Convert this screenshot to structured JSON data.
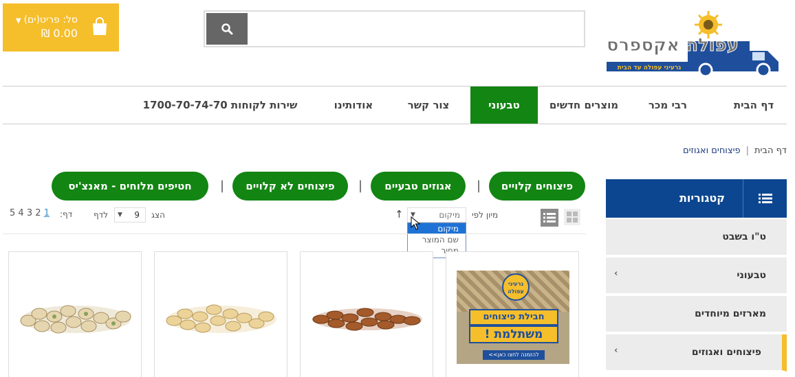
{
  "header": {
    "cart_label": "סל: פריט(ים)",
    "cart_total": "0.00 ₪",
    "search_placeholder": ""
  },
  "logo": {
    "name": "עפולה אקספרס",
    "tagline": "גרעיני עפולה עד הבית"
  },
  "nav": {
    "items": [
      {
        "label": "דף הבית"
      },
      {
        "label": "רבי מכר"
      },
      {
        "label": "מוצרים חדשים"
      },
      {
        "label": "טבעוני",
        "active": true
      },
      {
        "label": "צור קשר"
      },
      {
        "label": "אודותינו"
      },
      {
        "label": "שירות לקוחות 1700-70-74-70"
      }
    ]
  },
  "breadcrumb": {
    "home": "דף הבית",
    "current": "פיצוחים ואגוזים"
  },
  "sidebar": {
    "title": "קטגוריות",
    "items": [
      {
        "label": "ט\"ו בשבט"
      },
      {
        "label": "טבעוני",
        "arrow": "›"
      },
      {
        "label": "מארזים מיוחדים"
      },
      {
        "label": "פיצוחים ואגוזים",
        "arrow": "›",
        "selected": true
      }
    ]
  },
  "subcategories": [
    {
      "label": "פיצוחים קלויים"
    },
    {
      "label": "אגוזים טבעיים"
    },
    {
      "label": "פיצוחים לא קלויים"
    },
    {
      "label": "חטיפים מלוחים - מאנצ'יס"
    }
  ],
  "toolbar": {
    "sort_label": "מיון לפי",
    "sort_selected": "מיקום",
    "sort_options": [
      "מיקום",
      "שם המוצר",
      "מחיר"
    ],
    "show_label": "הצג",
    "per_page": "9",
    "per_page_suffix": "לדף",
    "page_label": "דף:",
    "pages": [
      "1",
      "2",
      "3",
      "4",
      "5"
    ]
  },
  "promo": {
    "line1": "חבילת פיצוחים",
    "line2": "משתלמת !",
    "cta": "להזמנה לחצו כאן>>",
    "badge": "גרעיני עפולה"
  },
  "colors": {
    "green": "#128512",
    "navy": "#0c4690",
    "yellow": "#f5be2b"
  }
}
